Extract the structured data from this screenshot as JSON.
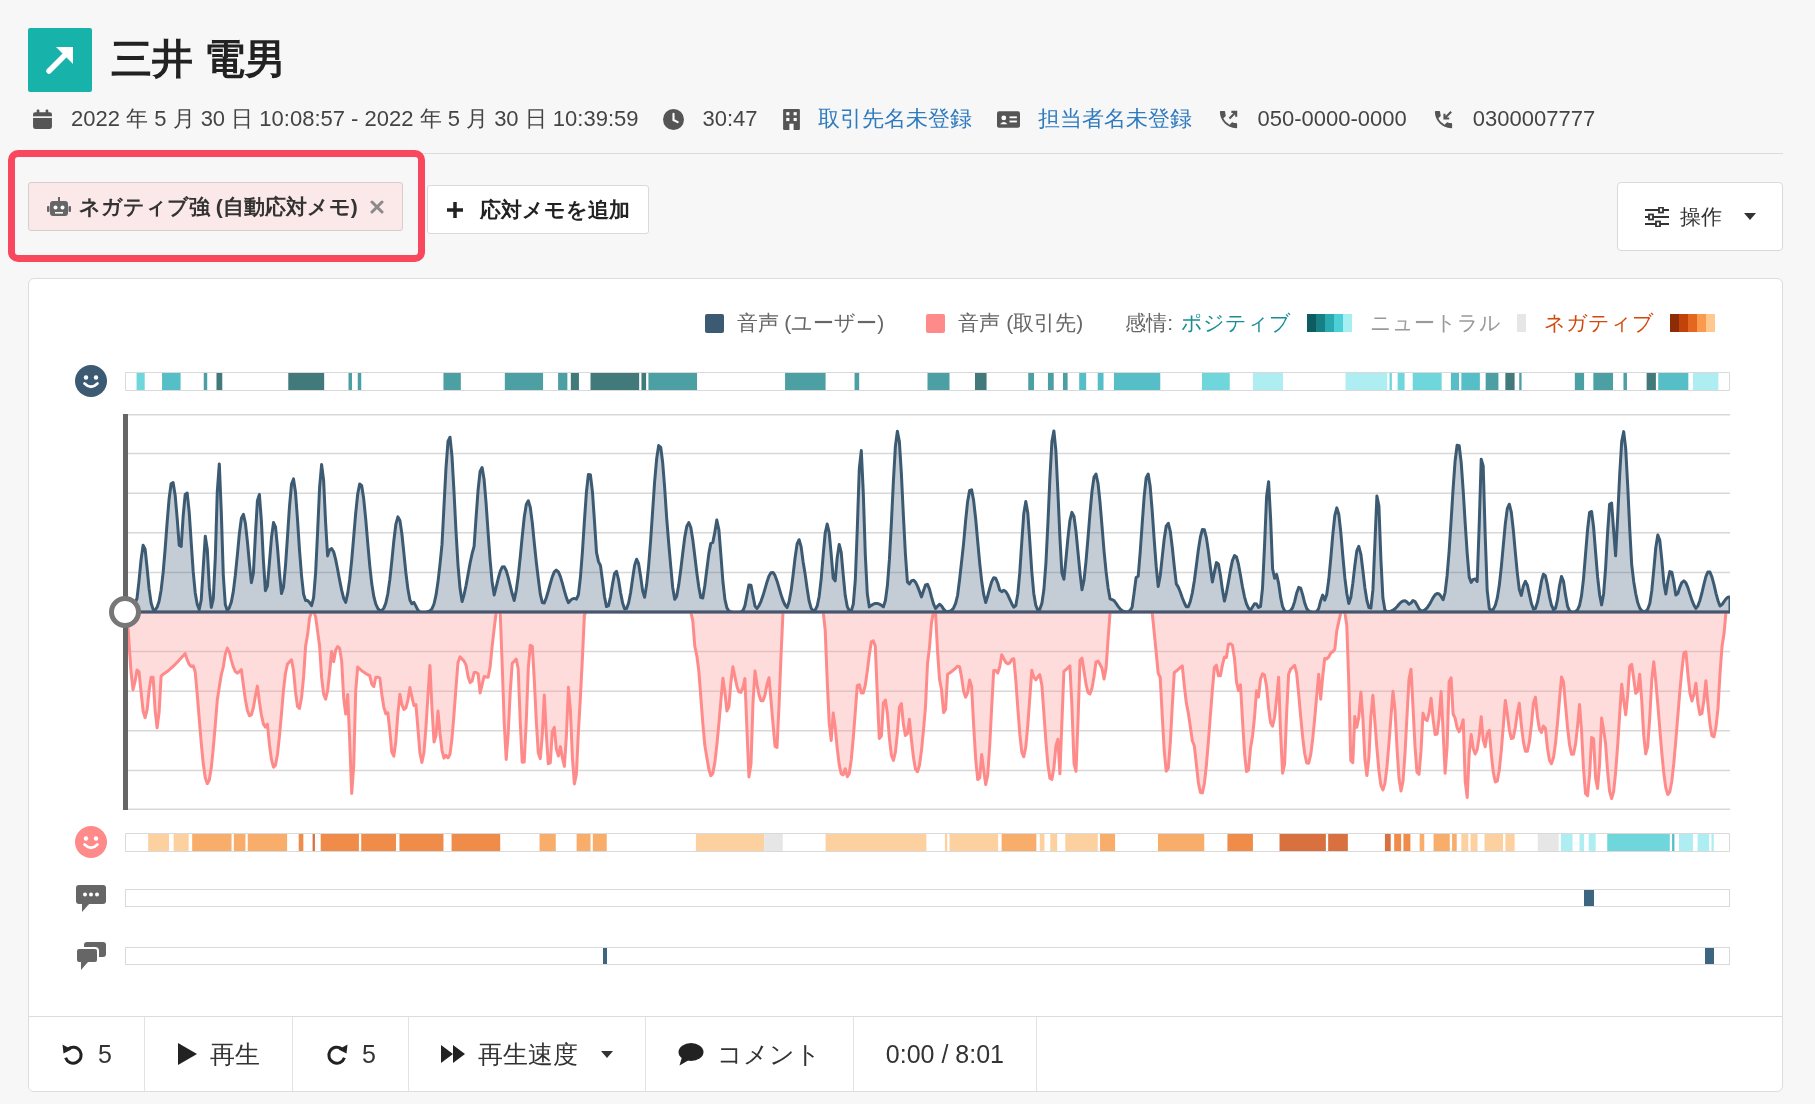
{
  "header": {
    "title": "三井 電男",
    "meta": [
      {
        "kind": "date",
        "text": "2022 年 5 月 30 日 10:08:57 - 2022 年 5 月 30 日 10:39:59",
        "link": false
      },
      {
        "kind": "duration",
        "text": "30:47",
        "link": false
      },
      {
        "kind": "company",
        "text": "取引先名未登録",
        "link": true
      },
      {
        "kind": "contact",
        "text": "担当者名未登録",
        "link": true
      },
      {
        "kind": "outgoing",
        "text": "050-0000-0000",
        "link": false
      },
      {
        "kind": "incoming",
        "text": "0300007777",
        "link": false
      }
    ]
  },
  "memo_tags": [
    {
      "label": "ネガティブ強 (自動応対メモ)",
      "highlighted": true
    }
  ],
  "add_memo_button": "応対メモを追加",
  "actions_button": "操作",
  "player": {
    "legend": [
      {
        "label": "音声 (ユーザー)",
        "color": "#3d5a73"
      },
      {
        "label": "音声 (取引先)",
        "color": "#ff8a8a"
      }
    ],
    "sentiment_legend": {
      "label": "感情:",
      "items": [
        {
          "kind": "positive",
          "label": "ポジティブ"
        },
        {
          "kind": "neutral",
          "label": "ニュートラル"
        },
        {
          "kind": "negative",
          "label": "ネガティブ"
        }
      ]
    },
    "playhead": {
      "level": 0
    },
    "controls": [
      {
        "kind": "back",
        "label": "5"
      },
      {
        "kind": "play",
        "label": "再生"
      },
      {
        "kind": "forward",
        "label": "5"
      },
      {
        "kind": "speed",
        "label": "再生速度"
      },
      {
        "kind": "comment",
        "label": "コメント"
      }
    ],
    "time": "0:00 / 8:01"
  }
}
